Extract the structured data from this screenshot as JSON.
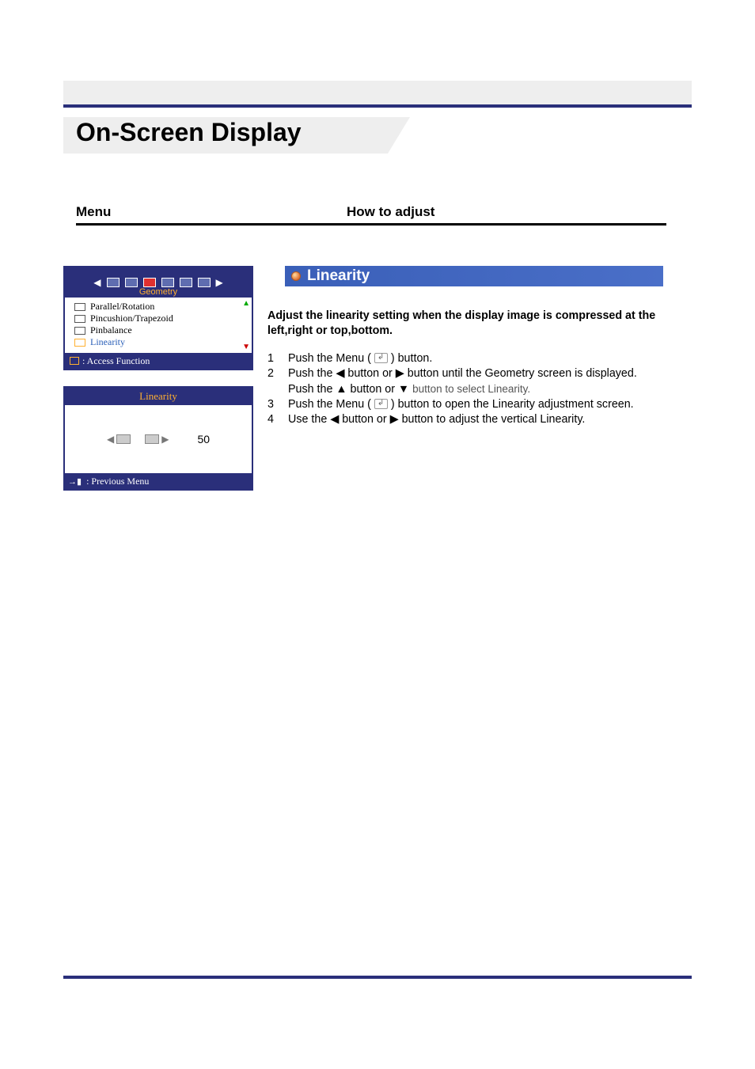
{
  "page_title": "On-Screen Display",
  "columns": {
    "menu_label": "Menu",
    "how_label": "How to adjust"
  },
  "osd_menu": {
    "category": "Geometry",
    "items": [
      "Parallel/Rotation",
      "Pincushion/Trapezoid",
      "Pinbalance",
      "Linearity"
    ],
    "footer": ": Access Function"
  },
  "osd_adjust": {
    "title": "Linearity",
    "value": "50",
    "footer": ": Previous Menu"
  },
  "section": {
    "title": "Linearity",
    "description": "Adjust the linearity setting when the display image is compressed at the left,right or top,bottom.",
    "steps": {
      "s1_a": "Push the Menu (",
      "s1_b": ") button.",
      "s2_a": "Push the ◀ button or ▶ button until the Geometry screen is displayed.",
      "s2_b_a": "Push the ▲ button or ▼",
      "s2_b_b": "button to select Linearity.",
      "s3_a": "Push the Menu (",
      "s3_b": ") button to open the Linearity adjustment screen.",
      "s4": "Use the ◀ button or ▶ button to adjust the vertical Linearity."
    }
  }
}
